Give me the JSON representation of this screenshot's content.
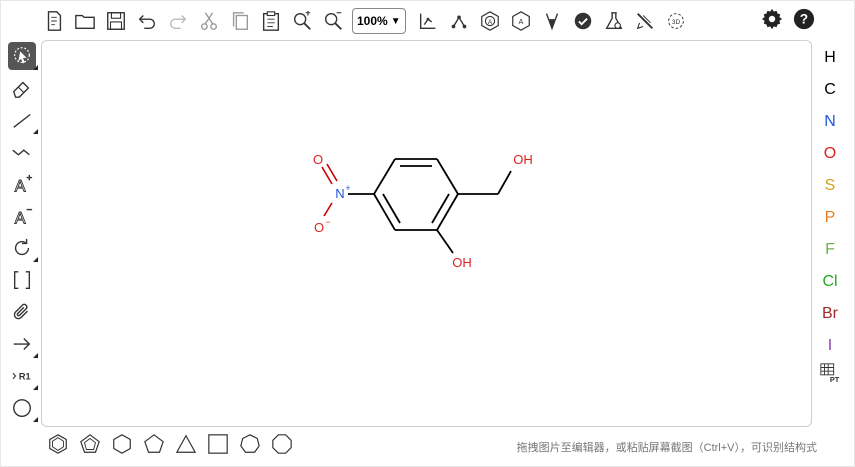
{
  "toolbar": {
    "zoom_value": "100%",
    "items": [
      "new-file",
      "open",
      "save",
      "undo",
      "redo",
      "cut",
      "copy",
      "paste",
      "zoom-in",
      "zoom-out"
    ],
    "tools_after_zoom": [
      "layout",
      "clean",
      "aromatize",
      "dearomatize",
      "stereo",
      "check",
      "analyze",
      "recognize",
      "3d-viewer"
    ]
  },
  "header_right": [
    "settings",
    "help"
  ],
  "left_tools": [
    "select",
    "eraser",
    "bond",
    "chain",
    "charge-plus",
    "charge-minus",
    "rotate",
    "brackets",
    "attachment",
    "reaction-arrow",
    "r-group",
    "shape-ellipse"
  ],
  "left_tool_labels": {
    "rgroup": "R1",
    "charge_plus": "A",
    "charge_minus": "A"
  },
  "elements": [
    {
      "symbol": "H",
      "color": "#000000"
    },
    {
      "symbol": "C",
      "color": "#000000"
    },
    {
      "symbol": "N",
      "color": "#2255dd"
    },
    {
      "symbol": "O",
      "color": "#dd2222"
    },
    {
      "symbol": "S",
      "color": "#d4a017"
    },
    {
      "symbol": "P",
      "color": "#e67e22"
    },
    {
      "symbol": "F",
      "color": "#6ab04c"
    },
    {
      "symbol": "Cl",
      "color": "#22aa22"
    },
    {
      "symbol": "Br",
      "color": "#a52a2a"
    },
    {
      "symbol": "I",
      "color": "#8e44ad"
    }
  ],
  "periodic_table_label": "PT",
  "molecule": {
    "labels": {
      "n": "N",
      "n_charge": "+",
      "o_top": "O",
      "o_minus": "O",
      "o_minus_charge": "−",
      "oh_top": "OH",
      "oh_bottom": "OH"
    }
  },
  "bottom_templates": [
    "benzene",
    "cyclopentadiene",
    "cyclohexane",
    "cyclopentane",
    "cyclopropane",
    "cyclobutane",
    "cycloheptane",
    "cyclooctane"
  ],
  "hint_text": "拖拽图片至编辑器，或粘贴屏幕截图（Ctrl+V），可识别结构式"
}
